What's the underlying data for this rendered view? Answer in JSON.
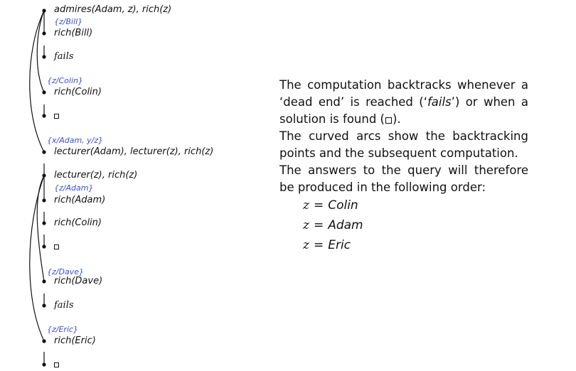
{
  "tree": {
    "nodes": [
      {
        "id": "n1",
        "label": "admires(Adam, z), rich(z)"
      },
      {
        "id": "n2",
        "label": "rich(Bill)"
      },
      {
        "id": "n3",
        "label": "fails"
      },
      {
        "id": "n4",
        "label": "rich(Colin)"
      },
      {
        "id": "n5",
        "label": "□"
      },
      {
        "id": "n6",
        "label": "lecturer(Adam), lecturer(z), rich(z)"
      },
      {
        "id": "n7",
        "label": "lecturer(z), rich(z)"
      },
      {
        "id": "n8",
        "label": "rich(Adam)"
      },
      {
        "id": "n9",
        "label": "rich(Colin)"
      },
      {
        "id": "n10",
        "label": "□"
      },
      {
        "id": "n11",
        "label": "rich(Dave)"
      },
      {
        "id": "n12",
        "label": "fails"
      },
      {
        "id": "n13",
        "label": "rich(Eric)"
      },
      {
        "id": "n14",
        "label": "□"
      }
    ],
    "substitutions": [
      {
        "id": "s1",
        "text": "{z/Bill}"
      },
      {
        "id": "s2",
        "text": "{z/Colin}"
      },
      {
        "id": "s3",
        "text": "{x/Adam, y/z}"
      },
      {
        "id": "s4",
        "text": "{z/Adam}"
      },
      {
        "id": "s5",
        "text": "{z/Dave}"
      },
      {
        "id": "s6",
        "text": "{z/Eric}"
      }
    ]
  },
  "explanation": {
    "para1_a": "The computation backtracks whenever a ‘dead end’ is reached (‘",
    "para1_fails": "fails",
    "para1_b": "’) or when a solution is found (",
    "para1_c": ").",
    "para2": "The curved arcs show the backtracking points and the subsequent computation.",
    "para3": "The answers to the query will therefore be produced in the following order:",
    "answers": [
      {
        "var": "z",
        "eq": "=",
        "value": "Colin"
      },
      {
        "var": "z",
        "eq": "=",
        "value": "Adam"
      },
      {
        "var": "z",
        "eq": "=",
        "value": "Eric"
      }
    ]
  },
  "colors": {
    "substitution": "#3b4fd4",
    "text": "#111111"
  }
}
